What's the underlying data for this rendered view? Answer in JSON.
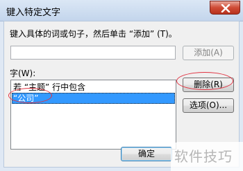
{
  "window": {
    "title": "键入特定文字"
  },
  "prompt": {
    "text": "键入具体的词或句子，然后单击 “添加”",
    "mnemonic": "(T)。"
  },
  "input": {
    "value": ""
  },
  "buttons": {
    "add": "添加(A)",
    "delete": "删除(R)",
    "options": "选项(O)...",
    "ok": "确定"
  },
  "list": {
    "label": "字(W):",
    "items": [
      "若 “主题” 行中包含",
      "“公司”"
    ],
    "selected_index": 1
  },
  "watermark": {
    "text": "软件技巧"
  },
  "colors": {
    "selection": "#3399ff",
    "annotation": "#e0303f",
    "close_button": "#cf4b35"
  }
}
